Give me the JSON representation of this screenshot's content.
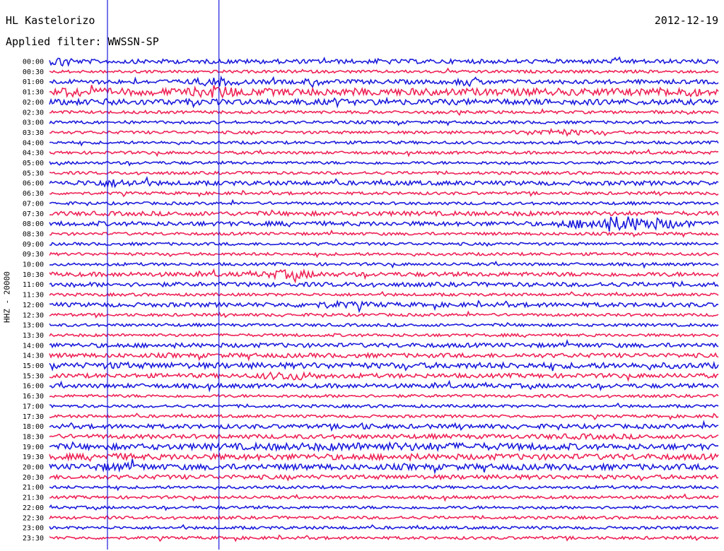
{
  "header": {
    "station": "HL Kastelorizo",
    "filter": "Applied filter: WWSSN-SP",
    "date": "2012-12-19"
  },
  "chart_data": {
    "type": "line",
    "title": "HL Kastelorizo",
    "subtitle": "Applied filter: WWSSN-SP",
    "date": "2012-12-19",
    "ylabel": "HHZ - 20000",
    "colors": [
      "#1a1adc",
      "#ee2255"
    ],
    "trace_rows": [
      "00:00",
      "00:30",
      "01:00",
      "01:30",
      "02:00",
      "02:30",
      "03:00",
      "03:30",
      "04:00",
      "04:30",
      "05:00",
      "05:30",
      "06:00",
      "06:30",
      "07:00",
      "07:30",
      "08:00",
      "08:30",
      "09:00",
      "09:30",
      "10:00",
      "10:30",
      "11:00",
      "11:30",
      "12:00",
      "12:30",
      "13:00",
      "13:30",
      "14:00",
      "14:30",
      "15:00",
      "15:30",
      "16:00",
      "16:30",
      "17:00",
      "17:30",
      "18:00",
      "18:30",
      "19:00",
      "19:30",
      "20:00",
      "20:30",
      "21:00",
      "21:30",
      "22:00",
      "22:30",
      "23:00",
      "23:30"
    ],
    "event_markers_minutes": [
      2.6,
      7.6
    ]
  }
}
